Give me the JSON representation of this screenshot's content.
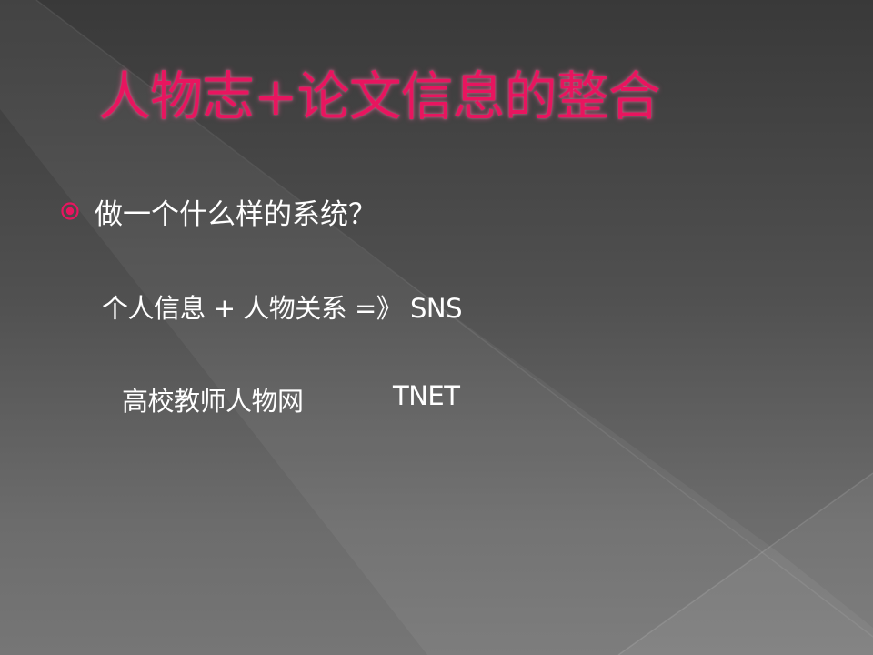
{
  "slide": {
    "title": "人物志+论文信息的整合",
    "bullet": {
      "icon": "circled-dot-bullet-icon",
      "text": "做一个什么样的系统？"
    },
    "lines": [
      {
        "text": "个人信息 + 人物关系 =》 SNS"
      },
      {
        "text_cn": "高校教师人物网",
        "text_en": "TNET"
      }
    ]
  },
  "colors": {
    "title": "#e8155f",
    "bullet": "#e8155f",
    "body_text": "#ffffff",
    "background_dark": "#393939",
    "background_light": "#767676"
  }
}
